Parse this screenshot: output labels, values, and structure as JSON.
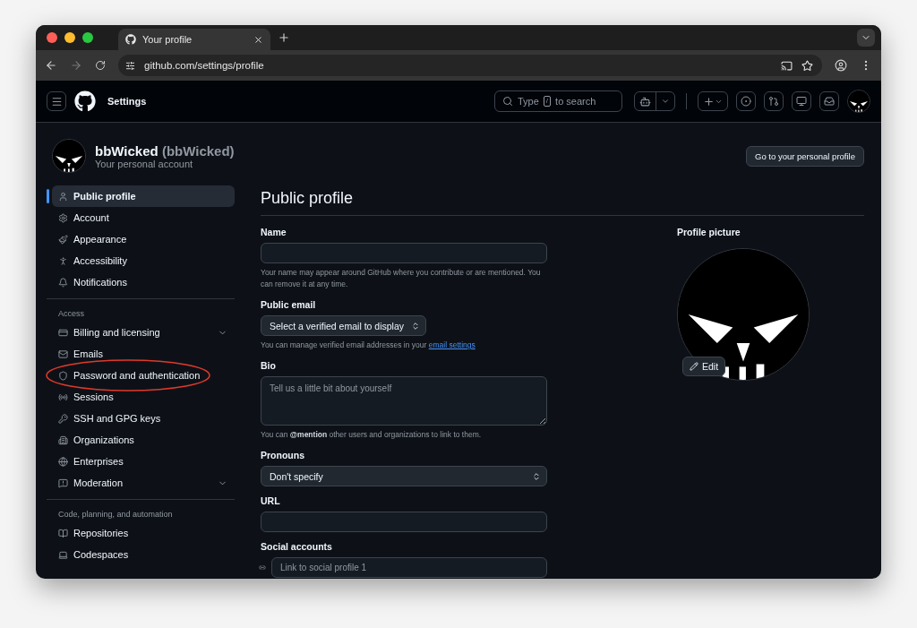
{
  "browser": {
    "tab_title": "Your profile",
    "address": "github.com/settings/profile"
  },
  "header": {
    "title": "Settings",
    "search": {
      "before": "Type",
      "key": "/",
      "after": "to search"
    }
  },
  "account": {
    "name": "bbWicked",
    "login": "(bbWicked)",
    "subtitle": "Your personal account",
    "profile_button": "Go to your personal profile"
  },
  "sidebar": {
    "sections": [
      {
        "items": [
          {
            "label": "Public profile",
            "selected": true,
            "kind": "link",
            "circled": false
          },
          {
            "label": "Account",
            "selected": false,
            "kind": "link",
            "circled": false
          },
          {
            "label": "Appearance",
            "selected": false,
            "kind": "link",
            "circled": false
          },
          {
            "label": "Accessibility",
            "selected": false,
            "kind": "link",
            "circled": false
          },
          {
            "label": "Notifications",
            "selected": false,
            "kind": "link",
            "circled": false
          }
        ]
      },
      {
        "heading": "Access",
        "items": [
          {
            "label": "Billing and licensing",
            "selected": false,
            "kind": "group",
            "circled": false
          },
          {
            "label": "Emails",
            "selected": false,
            "kind": "link",
            "circled": false
          },
          {
            "label": "Password and authentication",
            "selected": false,
            "kind": "link",
            "circled": true
          },
          {
            "label": "Sessions",
            "selected": false,
            "kind": "link",
            "circled": false
          },
          {
            "label": "SSH and GPG keys",
            "selected": false,
            "kind": "link",
            "circled": false
          },
          {
            "label": "Organizations",
            "selected": false,
            "kind": "link",
            "circled": false
          },
          {
            "label": "Enterprises",
            "selected": false,
            "kind": "link",
            "circled": false
          },
          {
            "label": "Moderation",
            "selected": false,
            "kind": "group",
            "circled": false
          }
        ]
      },
      {
        "heading": "Code, planning, and automation",
        "items": [
          {
            "label": "Repositories",
            "selected": false,
            "kind": "link",
            "circled": false
          },
          {
            "label": "Codespaces",
            "selected": false,
            "kind": "link",
            "circled": false
          }
        ]
      }
    ]
  },
  "page": {
    "title": "Public profile",
    "fields": [
      {
        "kind": "text",
        "label": "Name",
        "note": "Your name may appear around GitHub where you contribute or are mentioned. You can remove it at any time."
      },
      {
        "kind": "select",
        "label": "Public email",
        "value": "Select a verified email to display",
        "note": "You can manage verified email addresses in your",
        "note_link": "email settings"
      },
      {
        "kind": "textarea",
        "label": "Bio",
        "placeholder": "Tell us a little bit about yourself",
        "note": "You can **@mention** other users and organizations to link to them."
      },
      {
        "kind": "select_wide",
        "label": "Pronouns",
        "value": "Don't specify"
      },
      {
        "kind": "text",
        "label": "URL"
      },
      {
        "kind": "social",
        "label": "Social accounts",
        "placeholder": "Link to social profile 1"
      }
    ],
    "picture": {
      "label": "Profile picture",
      "edit_button": "Edit"
    }
  }
}
